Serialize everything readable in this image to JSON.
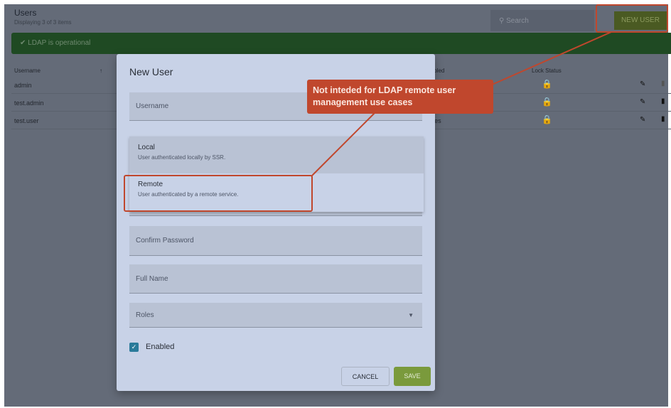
{
  "header": {
    "title": "Users",
    "subtitle": "Displaying 3 of 3 items",
    "search_placeholder": "Search",
    "new_user": "NEW USER"
  },
  "banner": {
    "text": "LDAP is operational",
    "icon": "check-circle-icon"
  },
  "table": {
    "columns": [
      "Username",
      "Enabled",
      "Lock Status"
    ],
    "sort_icon": "arrow-up-icon",
    "rows": [
      {
        "username": "admin",
        "enabled": ""
      },
      {
        "username": "test.admin",
        "enabled": ""
      },
      {
        "username": "test.user",
        "enabled": "Yes"
      }
    ]
  },
  "modal": {
    "title": "New User",
    "username_placeholder": "Username",
    "options": [
      {
        "label": "Local",
        "desc": "User authenticated locally by SSR."
      },
      {
        "label": "Remote",
        "desc": "User authenticated by a remote service."
      }
    ],
    "confirm_password": "Confirm Password",
    "full_name": "Full Name",
    "roles": "Roles",
    "enabled_label": "Enabled",
    "enabled": true,
    "cancel": "CANCEL",
    "save": "SAVE"
  },
  "annotation": {
    "text": "Not inteded for LDAP remote user management use cases",
    "color": "#c0472d"
  },
  "colors": {
    "accent_green": "#7a9a3c",
    "banner": "#1f4a23",
    "checkbox": "#2a7a9a"
  }
}
